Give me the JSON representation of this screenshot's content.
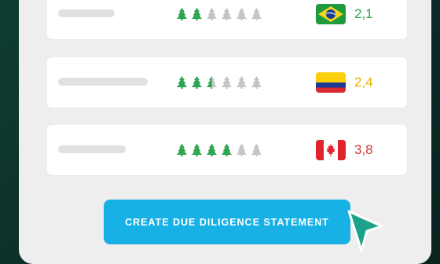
{
  "rows": [
    {
      "country_flag": "brazil-flag-icon",
      "score": "2,1",
      "score_color": "#27a54a",
      "trees_green": 2.0,
      "trees_total": 6
    },
    {
      "country_flag": "colombia-flag-icon",
      "score": "2,4",
      "score_color": "#e8b400",
      "trees_green": 2.5,
      "trees_total": 6
    },
    {
      "country_flag": "canada-flag-icon",
      "score": "3,8",
      "score_color": "#d33a32",
      "trees_green": 4.0,
      "trees_total": 6
    }
  ],
  "cta": {
    "label": "CREATE DUE DILIGENCE STATEMENT",
    "color": "#17b1e6"
  },
  "colors": {
    "tree_green": "#2ea552",
    "tree_gray": "#c4c4c4",
    "cursor": "#1aa38a"
  }
}
